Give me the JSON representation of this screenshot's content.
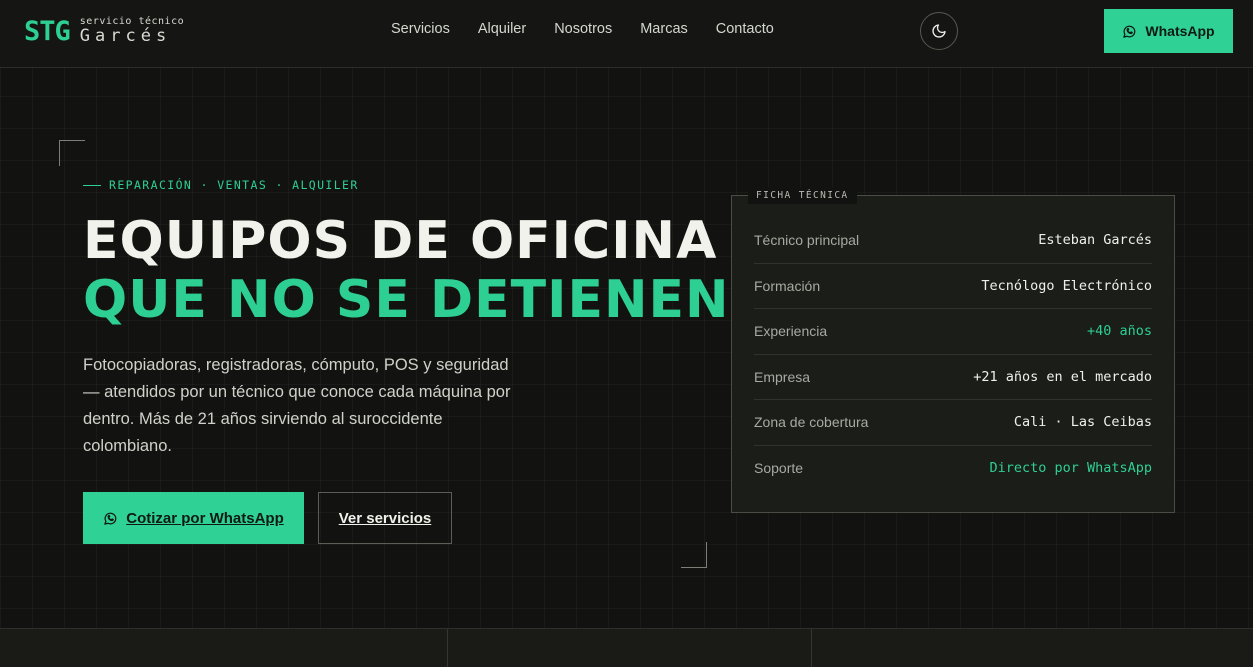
{
  "header": {
    "logo_mark": "STG",
    "logo_sub": "servicio técnico",
    "logo_name": "Garcés",
    "nav": [
      "Servicios",
      "Alquiler",
      "Nosotros",
      "Marcas",
      "Contacto"
    ],
    "theme_icon": "moon-icon",
    "whatsapp_label": "WhatsApp"
  },
  "hero": {
    "eyebrow": "REPARACIÓN · VENTAS · ALQUILER",
    "title_line1": "EQUIPOS DE OFICINA",
    "title_line2": "QUE NO SE DETIENEN",
    "lead": "Fotocopiadoras, registradoras, cómputo, POS y seguridad — atendidos por un técnico que conoce cada máquina por dentro. Más de 21 años sirviendo al suroccidente colombiano.",
    "cta_primary": "Cotizar por WhatsApp",
    "cta_secondary": "Ver servicios"
  },
  "tech_card": {
    "tag": "FICHA TÉCNICA",
    "rows": [
      {
        "label": "Técnico principal",
        "value": "Esteban Garcés"
      },
      {
        "label": "Formación",
        "value": "Tecnólogo Electrónico"
      },
      {
        "label": "Experiencia",
        "value": "+40 años"
      },
      {
        "label": "Empresa",
        "value": "+21 años en el mercado"
      },
      {
        "label": "Zona de cobertura",
        "value": "Cali · Las Ceibas"
      },
      {
        "label": "Soporte",
        "value": "Directo por WhatsApp"
      }
    ]
  },
  "colors": {
    "accent": "#2ecf92",
    "background": "#121310"
  }
}
